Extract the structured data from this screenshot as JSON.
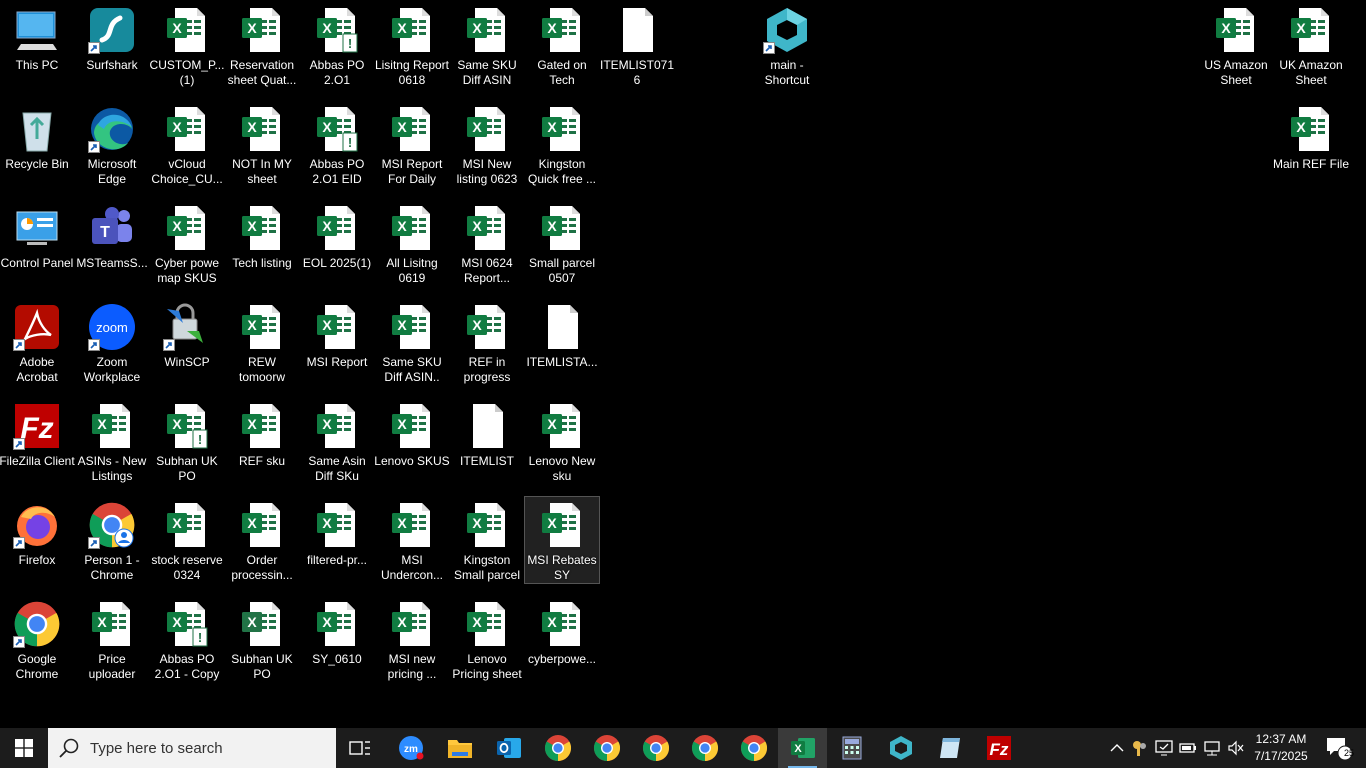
{
  "desktop_icons": [
    {
      "label": "This PC",
      "type": "pc"
    },
    {
      "label": "Recycle Bin",
      "type": "recycle"
    },
    {
      "label": "Control Panel",
      "type": "control"
    },
    {
      "label": "Adobe Acrobat",
      "type": "acrobat"
    },
    {
      "label": "FileZilla Client",
      "type": "filezilla"
    },
    {
      "label": "Firefox",
      "type": "firefox"
    },
    {
      "label": "Google Chrome",
      "type": "chrome"
    },
    {
      "label": "Surfshark",
      "type": "surfshark"
    },
    {
      "label": "Microsoft Edge",
      "type": "edge"
    },
    {
      "label": "MSTeamsS...",
      "type": "teams"
    },
    {
      "label": "Zoom Workplace",
      "type": "zoom"
    },
    {
      "label": "ASINs - New Listings",
      "type": "excel"
    },
    {
      "label": "Person 1 - Chrome",
      "type": "chrome-person"
    },
    {
      "label": "Price uploader",
      "type": "excel"
    },
    {
      "label": "CUSTOM_P... (1)",
      "type": "excel"
    },
    {
      "label": "vCloud Choice_CU...",
      "type": "excel"
    },
    {
      "label": "Cyber powe map SKUS",
      "type": "excel"
    },
    {
      "label": "WinSCP",
      "type": "winscp"
    },
    {
      "label": "Subhan UK PO",
      "type": "excel-warn"
    },
    {
      "label": "stock reserve 0324",
      "type": "excel"
    },
    {
      "label": "Abbas PO 2.O1 - Copy",
      "type": "excel-warn"
    },
    {
      "label": "Reservation sheet Quat...",
      "type": "excel"
    },
    {
      "label": "NOT In MY sheet",
      "type": "excel"
    },
    {
      "label": "Tech listing",
      "type": "excel"
    },
    {
      "label": "REW tomoorw",
      "type": "excel"
    },
    {
      "label": "REF sku",
      "type": "excel"
    },
    {
      "label": "Order processin...",
      "type": "excel"
    },
    {
      "label": "Subhan UK PO",
      "type": "excel-old"
    },
    {
      "label": "Abbas PO 2.O1",
      "type": "excel-warn"
    },
    {
      "label": "Abbas PO 2.O1  EID",
      "type": "excel-warn"
    },
    {
      "label": "EOL 2025(1)",
      "type": "excel"
    },
    {
      "label": "MSI Report",
      "type": "excel"
    },
    {
      "label": "Same Asin Diff SKu",
      "type": "excel"
    },
    {
      "label": "filtered-pr...",
      "type": "excel"
    },
    {
      "label": "SY_0610",
      "type": "excel"
    },
    {
      "label": "Lisitng Report 0618",
      "type": "excel"
    },
    {
      "label": "MSI Report For Daily",
      "type": "excel"
    },
    {
      "label": "All Lisitng 0619",
      "type": "excel"
    },
    {
      "label": "Same SKU Diff ASIN..",
      "type": "excel"
    },
    {
      "label": "Lenovo SKUS",
      "type": "excel"
    },
    {
      "label": "MSI Undercon...",
      "type": "excel"
    },
    {
      "label": "MSI new pricing ...",
      "type": "excel"
    },
    {
      "label": "Same SKU Diff ASIN",
      "type": "excel"
    },
    {
      "label": "MSI New listing 0623",
      "type": "excel"
    },
    {
      "label": "MSI 0624 Report...",
      "type": "excel"
    },
    {
      "label": "REF in progress",
      "type": "excel"
    },
    {
      "label": "ITEMLIST",
      "type": "blank"
    },
    {
      "label": "Kingston Small parcel",
      "type": "excel"
    },
    {
      "label": "Lenovo Pricing sheet",
      "type": "excel"
    },
    {
      "label": "Gated on Tech",
      "type": "excel"
    },
    {
      "label": "Kingston Quick free ...",
      "type": "excel"
    },
    {
      "label": "Small parcel 0507",
      "type": "excel"
    },
    {
      "label": "ITEMLISTA...",
      "type": "blank"
    },
    {
      "label": "Lenovo New sku",
      "type": "excel"
    },
    {
      "label": "MSI Rebates SY",
      "type": "excel",
      "selected": true
    },
    {
      "label": "cyberpowe...",
      "type": "excel"
    },
    {
      "label": "ITEMLIST0716",
      "type": "blank"
    },
    {
      "label": "main - Shortcut",
      "type": "cube"
    },
    {
      "label": "US Amazon Sheet",
      "type": "excel"
    },
    {
      "label": "UK Amazon Sheet",
      "type": "excel"
    },
    {
      "label": "Main REF File",
      "type": "excel"
    }
  ],
  "taskbar": {
    "search_placeholder": "Type here to search",
    "apps": [
      {
        "name": "start-icon"
      },
      {
        "name": "task-view-icon"
      },
      {
        "name": "zoom-icon"
      },
      {
        "name": "file-explorer-icon"
      },
      {
        "name": "outlook-icon"
      },
      {
        "name": "chrome-icon"
      },
      {
        "name": "chrome-icon"
      },
      {
        "name": "chrome-icon"
      },
      {
        "name": "chrome-icon"
      },
      {
        "name": "chrome-icon"
      },
      {
        "name": "excel-icon"
      },
      {
        "name": "calculator-icon"
      },
      {
        "name": "cube-app-icon"
      },
      {
        "name": "notepad-icon"
      },
      {
        "name": "filezilla-icon"
      }
    ],
    "clock_time": "12:37 AM",
    "clock_date": "7/17/2025",
    "notification_count": "25"
  },
  "colors": {
    "excel_green": "#1e7145",
    "taskbar_bg": "#1c1c1c",
    "accent": "#76b9ed"
  }
}
